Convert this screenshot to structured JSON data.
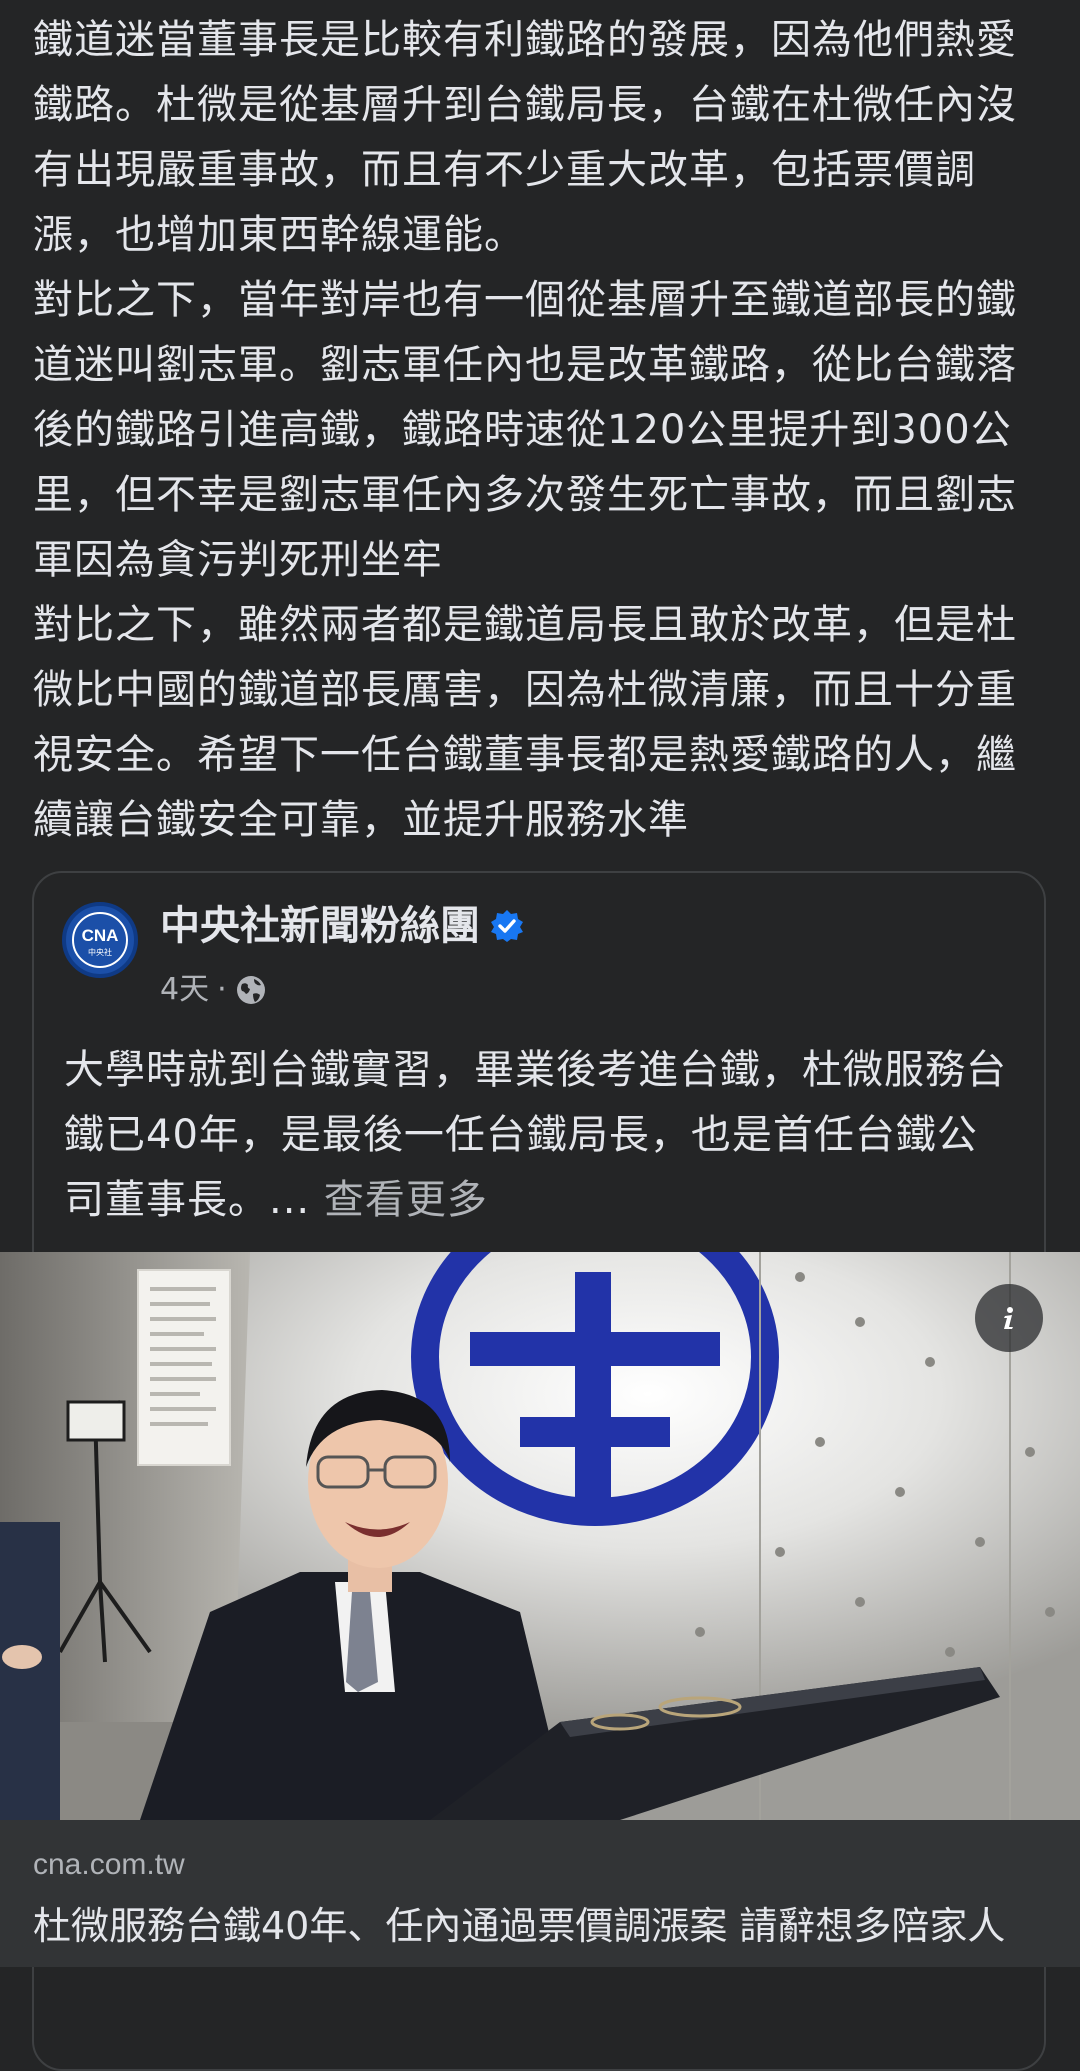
{
  "post": {
    "paragraphs": [
      "鐵道迷當董事長是比較有利鐵路的發展，因為他們熱愛鐵路。杜微是從基層升到台鐵局長，台鐵在杜微任內沒有出現嚴重事故，而且有不少重大改革，包括票價調漲，也增加東西幹線運能。",
      "對比之下，當年對岸也有一個從基層升至鐵道部長的鐵道迷叫劉志軍。劉志軍任內也是改革鐵路，從比台鐵落後的鐵路引進高鐵，鐵路時速從120公里提升到300公里，但不幸是劉志軍任內多次發生死亡事故，而且劉志軍因為貪污判死刑坐牢",
      "對比之下，雖然兩者都是鐵道局長且敢於改革，但是杜微比中國的鐵道部長厲害，因為杜微清廉，而且十分重視安全。希望下一任台鐵董事長都是熱愛鐵路的人，繼續讓台鐵安全可靠，並提升服務水準"
    ]
  },
  "shared_post": {
    "avatar_text": "CNA",
    "avatar_subtext": "中央社",
    "page_name": "中央社新聞粉絲團",
    "time": "4天",
    "separator": "·",
    "text": "大學時就到台鐵實習，畢業後考進台鐵，杜微服務台鐵已40年，是最後一任台鐵局長，也是首任台鐵公司董事長。",
    "ellipsis": "...",
    "see_more": "查看更多"
  },
  "link_preview": {
    "domain": "cna.com.tw",
    "title": "杜微服務台鐵40年、任內通過票價調漲案 請辭想多陪家人"
  },
  "icons": {
    "verified": "verified-badge-icon",
    "audience": "globe-icon",
    "info": "info-icon"
  },
  "colors": {
    "background": "#242526",
    "text_primary": "#e4e6eb",
    "text_secondary": "#b0b3b8",
    "verified": "#1877f2"
  }
}
